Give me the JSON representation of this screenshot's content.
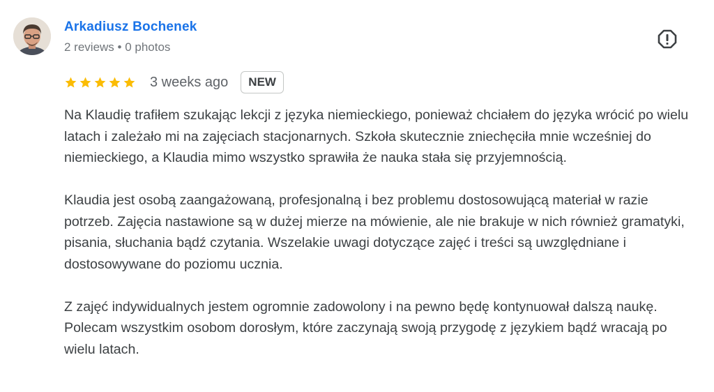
{
  "author": {
    "name": "Arkadiusz Bochenek",
    "meta": "2 reviews • 0 photos"
  },
  "rating": {
    "stars": 5,
    "icon": "star-icon",
    "color": "#fbbc04"
  },
  "time": "3 weeks ago",
  "badge": "NEW",
  "report_icon": "report-icon",
  "review_paragraphs": [
    "Na Klaudię trafiłem szukając lekcji z języka niemieckiego, ponieważ chciałem do języka wrócić po wielu latach i zależało mi na zajęciach stacjonarnych. Szkoła skutecznie zniechęciła mnie wcześniej do niemieckiego, a Klaudia mimo wszystko sprawiła że nauka stała się przyjemnością.",
    "Klaudia jest osobą zaangażowaną, profesjonalną i bez problemu dostosowującą materiał w razie potrzeb. Zajęcia nastawione są w dużej mierze na mówienie, ale nie brakuje w nich również gramatyki, pisania, słuchania bądź czytania. Wszelakie uwagi dotyczące zajęć i treści są uwzględniane i dostosowywane do poziomu ucznia.",
    "Z zajęć indywidualnych jestem ogromnie zadowolony i na pewno będę kontynuował dalszą naukę. Polecam wszystkim osobom dorosłym, które zaczynają swoją przygodę z językiem bądź wracają po wielu latach."
  ],
  "colors": {
    "link": "#1a73e8",
    "star": "#fbbc04",
    "text": "#3c4043",
    "meta": "#70757a"
  }
}
